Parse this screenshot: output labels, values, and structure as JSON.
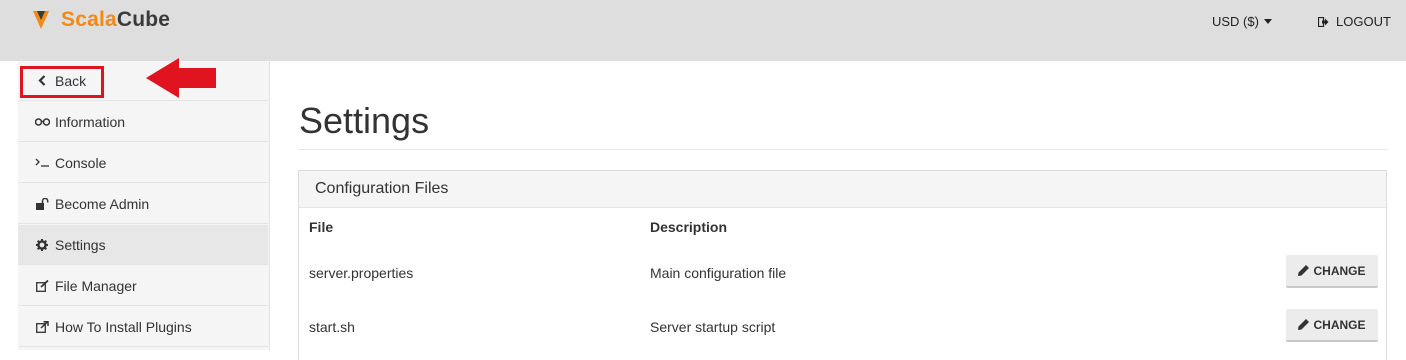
{
  "brand": {
    "part1": "Scala",
    "part2": "Cube",
    "accent_color": "#f28a15"
  },
  "header": {
    "currency_label": "USD ($)",
    "logout_label": "LOGOUT"
  },
  "sidebar": {
    "items": [
      {
        "label": "Back",
        "icon": "chevron-left-icon"
      },
      {
        "label": "Information",
        "icon": "glasses-icon"
      },
      {
        "label": "Console",
        "icon": "terminal-icon"
      },
      {
        "label": "Become Admin",
        "icon": "unlock-icon"
      },
      {
        "label": "Settings",
        "icon": "gear-icon",
        "active": true
      },
      {
        "label": "File Manager",
        "icon": "edit-icon"
      },
      {
        "label": "How To Install Plugins",
        "icon": "external-link-icon"
      }
    ],
    "highlight_color": "#e0141e"
  },
  "main": {
    "title": "Settings",
    "panel_title": "Configuration Files",
    "columns": [
      "File",
      "Description"
    ],
    "rows": [
      {
        "file": "server.properties",
        "description": "Main configuration file",
        "action": "CHANGE"
      },
      {
        "file": "start.sh",
        "description": "Server startup script",
        "action": "CHANGE"
      }
    ]
  }
}
